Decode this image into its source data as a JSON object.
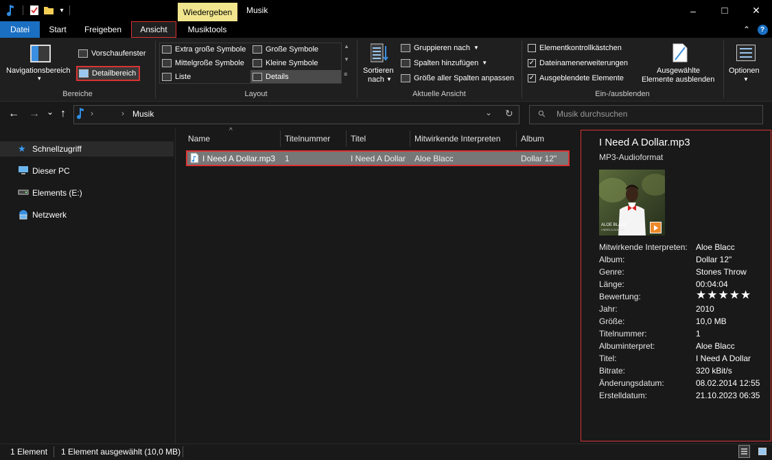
{
  "window": {
    "title": "Musik",
    "context_tab": "Wiedergeben",
    "minimize_glyph": "–",
    "maximize_glyph": "□",
    "close_glyph": "✕"
  },
  "quick_access": {
    "icons": [
      "music-note-icon",
      "checklist-icon",
      "folder-icon",
      "customize-chevron-icon"
    ],
    "dropdown_glyph": "▾"
  },
  "tabs": {
    "datei": "Datei",
    "start": "Start",
    "freigeben": "Freigeben",
    "ansicht": "Ansicht",
    "musiktools": "Musiktools",
    "collapse_glyph": "⌃",
    "help_glyph": "?"
  },
  "ribbon": {
    "bereiche": {
      "label": "Bereiche",
      "navigationsbereich": "Navigationsbereich",
      "vorschaufenster": "Vorschaufenster",
      "detailbereich": "Detailbereich"
    },
    "layout": {
      "label": "Layout",
      "items": [
        "Extra große Symbole",
        "Große Symbole",
        "Mittelgroße Symbole",
        "Kleine Symbole",
        "Liste",
        "Details"
      ]
    },
    "aktuelle_ansicht": {
      "label": "Aktuelle Ansicht",
      "sortieren_line1": "Sortieren",
      "sortieren_line2": "nach",
      "gruppieren": "Gruppieren nach",
      "spalten": "Spalten hinzufügen",
      "groesse": "Größe aller Spalten anpassen"
    },
    "ein_ausblenden": {
      "label": "Ein-/ausblenden",
      "kontrollkaestchen": "Elementkontrollkästchen",
      "kontrollkaestchen_checked": false,
      "erweiterungen": "Dateinamenerweiterungen",
      "erweiterungen_checked": true,
      "ausgeblendete": "Ausgeblendete Elemente",
      "ausgeblendete_checked": true,
      "ausgewaehlte_line1": "Ausgewählte",
      "ausgewaehlte_line2": "Elemente ausblenden"
    },
    "optionen": "Optionen",
    "check_glyph": "✓"
  },
  "address": {
    "back_glyph": "←",
    "forward_glyph": "→",
    "recent_glyph": "⌄",
    "up_glyph": "↑",
    "sep_glyph": "›",
    "path": "Musik",
    "dropdown_glyph": "⌄",
    "refresh_glyph": "↻",
    "search_placeholder": "Musik durchsuchen",
    "search_glyph": "⚲"
  },
  "nav": {
    "items": [
      {
        "label": "Schnellzugriff",
        "icon": "star-icon",
        "glyph": "★",
        "color": "#3a9df5"
      },
      {
        "label": "Dieser PC",
        "icon": "monitor-icon",
        "glyph": "🖥",
        "color": "#6cb6f0"
      },
      {
        "label": "Elements (E:)",
        "icon": "drive-icon",
        "glyph": "▭",
        "color": "#cccccc"
      },
      {
        "label": "Netzwerk",
        "icon": "network-icon",
        "glyph": "🖧",
        "color": "#6cb6f0"
      }
    ]
  },
  "filelist": {
    "sort_glyph": "^",
    "columns": [
      "Name",
      "Titelnummer",
      "Titel",
      "Mitwirkende Interpreten",
      "Album"
    ],
    "rows": [
      {
        "name": "I Need A Dollar.mp3",
        "track": "1",
        "title": "I Need A Dollar",
        "artists": "Aloe Blacc",
        "album": "Dollar 12\""
      }
    ]
  },
  "details": {
    "filename": "I Need A Dollar.mp3",
    "filetype": "MP3-Audioformat",
    "cover_text_line1": "ALOE BLACC",
    "cover_text_line2": "I NEED A DOLLAR",
    "rating_glyphs": "★★★★★",
    "properties": [
      {
        "label": "Mitwirkende Interpreten:",
        "value": "Aloe Blacc"
      },
      {
        "label": "Album:",
        "value": "Dollar 12\""
      },
      {
        "label": "Genre:",
        "value": "Stones Throw"
      },
      {
        "label": "Länge:",
        "value": "00:04:04"
      },
      {
        "label": "Bewertung:",
        "value": ""
      },
      {
        "label": "Jahr:",
        "value": "2010"
      },
      {
        "label": "Größe:",
        "value": "10,0 MB"
      },
      {
        "label": "Titelnummer:",
        "value": "1"
      },
      {
        "label": "Albuminterpret:",
        "value": "Aloe Blacc"
      },
      {
        "label": "Titel:",
        "value": "I Need A Dollar"
      },
      {
        "label": "Bitrate:",
        "value": "320 kBit/s"
      },
      {
        "label": "Änderungsdatum:",
        "value": "08.02.2014 12:55"
      },
      {
        "label": "Erstelldatum:",
        "value": "21.10.2023 06:35"
      }
    ]
  },
  "status": {
    "count": "1 Element",
    "selected": "1 Element ausgewählt (10,0 MB)"
  },
  "colors": {
    "accent_blue": "#1a6fc2",
    "highlight_red": "#dd3333",
    "context_yellow": "#f1e68d"
  }
}
